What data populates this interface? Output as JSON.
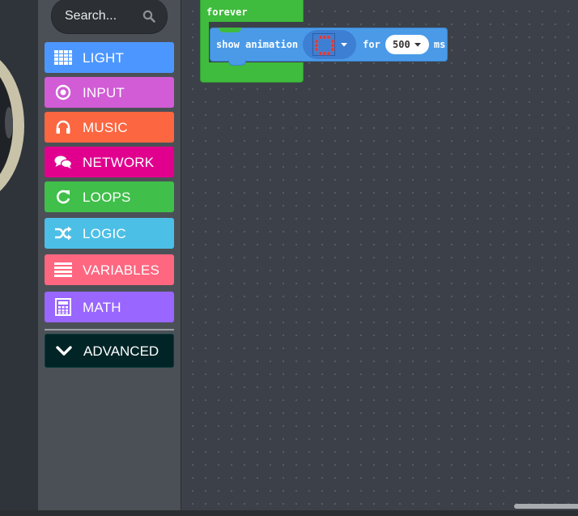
{
  "search": {
    "placeholder": "Search..."
  },
  "toolbox": {
    "categories": [
      {
        "id": "light",
        "label": "LIGHT",
        "color": "#4c97ff",
        "icon": "grid-icon"
      },
      {
        "id": "input",
        "label": "INPUT",
        "color": "#d15cd6",
        "icon": "target-icon"
      },
      {
        "id": "music",
        "label": "MUSIC",
        "color": "#fc6640",
        "icon": "headphones-icon"
      },
      {
        "id": "network",
        "label": "NETWORK",
        "color": "#e1008e",
        "icon": "chat-icon"
      },
      {
        "id": "loops",
        "label": "LOOPS",
        "color": "#40bf4a",
        "icon": "refresh-icon"
      },
      {
        "id": "logic",
        "label": "LOGIC",
        "color": "#4cbfe6",
        "icon": "shuffle-icon"
      },
      {
        "id": "variables",
        "label": "VARIABLES",
        "color": "#ff6680",
        "icon": "list-icon"
      },
      {
        "id": "math",
        "label": "MATH",
        "color": "#9966ff",
        "icon": "calculator-icon"
      }
    ],
    "advanced": {
      "label": "ADVANCED",
      "color": "#012426",
      "icon": "chevron-down-icon"
    }
  },
  "workspace": {
    "forever_block": {
      "label": "forever",
      "color": "#3fbb3d"
    },
    "show_animation_block": {
      "label": "show animation",
      "for_label": "for",
      "duration": "500",
      "unit_label": "ms",
      "color": "#4a9ae8"
    }
  }
}
